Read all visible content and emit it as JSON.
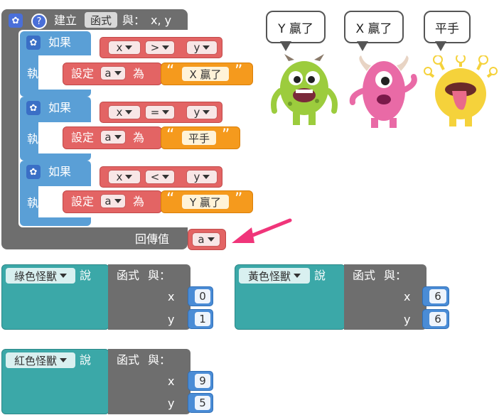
{
  "function_block": {
    "define_label": "建立",
    "function_name": "函式",
    "with_label": "與：",
    "params": "x, y",
    "return_label": "回傳值",
    "return_var": "a",
    "if_blocks": [
      {
        "if_label": "如果",
        "do_label": "執行",
        "left": "x",
        "op": ">",
        "right": "y",
        "set_label": "設定",
        "var": "a",
        "to_label": "為",
        "value": "X 贏了"
      },
      {
        "if_label": "如果",
        "do_label": "執行",
        "left": "x",
        "op": "=",
        "right": "y",
        "set_label": "設定",
        "var": "a",
        "to_label": "為",
        "value": "平手"
      },
      {
        "if_label": "如果",
        "do_label": "執行",
        "left": "x",
        "op": "<",
        "right": "y",
        "set_label": "設定",
        "var": "a",
        "to_label": "為",
        "value": "Y 贏了"
      }
    ]
  },
  "monsters": [
    {
      "name": "green-monster",
      "bubble": "Y 贏了",
      "color": "#9ccc3d"
    },
    {
      "name": "pink-monster",
      "bubble": "X 贏了",
      "color": "#e96aa6"
    },
    {
      "name": "yellow-monster",
      "bubble": "平手",
      "color": "#f5d23b"
    }
  ],
  "call_blocks": [
    {
      "monster": "綠色怪獸",
      "say_label": "說",
      "fn_label": "函式",
      "with_label": "與：",
      "x_label": "x",
      "y_label": "y",
      "x": "0",
      "y": "1"
    },
    {
      "monster": "黃色怪獸",
      "say_label": "說",
      "fn_label": "函式",
      "with_label": "與：",
      "x_label": "x",
      "y_label": "y",
      "x": "6",
      "y": "6"
    },
    {
      "monster": "紅色怪獸",
      "say_label": "說",
      "fn_label": "函式",
      "with_label": "與：",
      "x_label": "x",
      "y_label": "y",
      "x": "9",
      "y": "5"
    }
  ],
  "colors": {
    "function_block": "#6e6e6e",
    "if_block": "#5a9fd6",
    "set_block": "#e36464",
    "string_block": "#f59a1d",
    "number_block": "#4a8cd6",
    "call_block": "#3ba8a8",
    "arrow": "#f0357a"
  }
}
